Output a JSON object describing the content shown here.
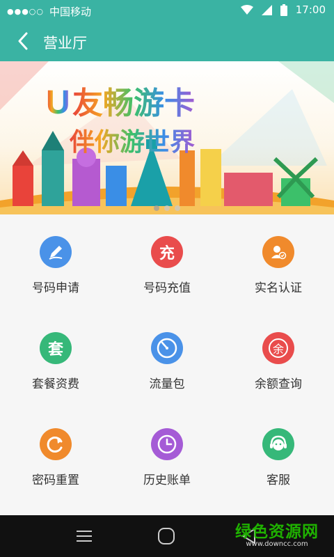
{
  "status_bar": {
    "signal_dots": "●●●○○",
    "carrier": "中国移动",
    "time": "17:00"
  },
  "app_bar": {
    "title": "营业厅"
  },
  "banner": {
    "line1_prefix": "U",
    "line1": "友畅游卡",
    "line2": "伴你游世界",
    "slides": 3,
    "active_slide": 1
  },
  "services": [
    {
      "label": "号码申请",
      "icon": "pen-icon",
      "color": "#4a92e8"
    },
    {
      "label": "号码充值",
      "icon": "recharge-icon",
      "glyph": "充",
      "color": "#e94c4c"
    },
    {
      "label": "实名认证",
      "icon": "user-verify-icon",
      "color": "#f08a2c"
    },
    {
      "label": "套餐资费",
      "icon": "package-icon",
      "glyph": "套",
      "color": "#36b879"
    },
    {
      "label": "流量包",
      "icon": "data-gauge-icon",
      "color": "#4a92e8"
    },
    {
      "label": "余额查询",
      "icon": "balance-search-icon",
      "glyph": "余",
      "color": "#e94c4c"
    },
    {
      "label": "密码重置",
      "icon": "reset-icon",
      "color": "#f08a2c"
    },
    {
      "label": "历史账单",
      "icon": "clock-bill-icon",
      "color": "#a55bd6"
    },
    {
      "label": "客服",
      "icon": "customer-service-icon",
      "color": "#36b879"
    }
  ],
  "watermark": {
    "title": "绿色资源网",
    "url": "www.downcc.com"
  },
  "colors": {
    "accent": "#3ab3a3",
    "navbar": "#111111"
  }
}
